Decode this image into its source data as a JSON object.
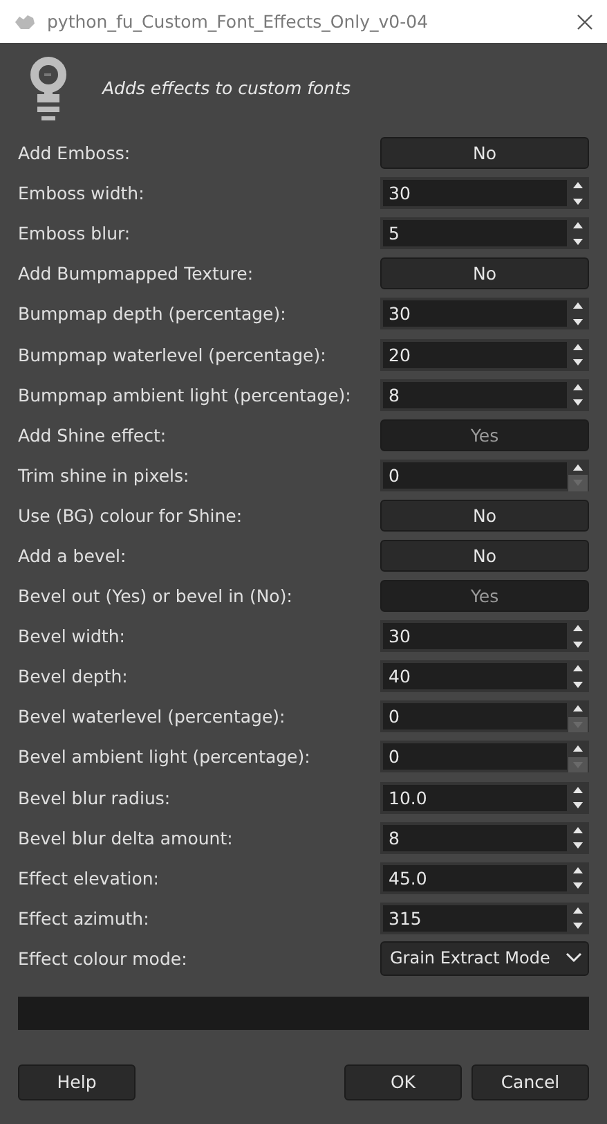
{
  "window": {
    "title": "python_fu_Custom_Font_Effects_Only_v0-04"
  },
  "description": "Adds effects to custom fonts",
  "params": [
    {
      "kind": "toggle",
      "label": "Add Emboss:",
      "value": "No",
      "on": false
    },
    {
      "kind": "spin",
      "label": "Emboss width:",
      "value": "30",
      "at_minimum": false
    },
    {
      "kind": "spin",
      "label": "Emboss blur:",
      "value": "5",
      "at_minimum": false
    },
    {
      "kind": "toggle",
      "label": "Add Bumpmapped Texture:",
      "value": "No",
      "on": false
    },
    {
      "kind": "spin",
      "label": "Bumpmap depth (percentage):",
      "value": "30",
      "at_minimum": false
    },
    {
      "kind": "spin",
      "label": "Bumpmap waterlevel (percentage):",
      "value": "20",
      "at_minimum": false
    },
    {
      "kind": "spin",
      "label": "Bumpmap ambient light (percentage):",
      "value": "8",
      "at_minimum": false
    },
    {
      "kind": "toggle",
      "label": "Add Shine effect:",
      "value": "Yes",
      "on": true
    },
    {
      "kind": "spin",
      "label": "Trim shine in pixels:",
      "value": "0",
      "at_minimum": true
    },
    {
      "kind": "toggle",
      "label": "Use (BG) colour for Shine:",
      "value": "No",
      "on": false
    },
    {
      "kind": "toggle",
      "label": "Add a bevel:",
      "value": "No",
      "on": false
    },
    {
      "kind": "toggle",
      "label": "Bevel out (Yes) or bevel in (No):",
      "value": "Yes",
      "on": true
    },
    {
      "kind": "spin",
      "label": "Bevel width:",
      "value": "30",
      "at_minimum": false
    },
    {
      "kind": "spin",
      "label": "Bevel depth:",
      "value": "40",
      "at_minimum": false
    },
    {
      "kind": "spin",
      "label": "Bevel waterlevel (percentage):",
      "value": "0",
      "at_minimum": true
    },
    {
      "kind": "spin",
      "label": "Bevel ambient light (percentage):",
      "value": "0",
      "at_minimum": true
    },
    {
      "kind": "spin",
      "label": "Bevel blur radius:",
      "value": "10.0",
      "at_minimum": false
    },
    {
      "kind": "spin",
      "label": "Bevel blur delta amount:",
      "value": "8",
      "at_minimum": false
    },
    {
      "kind": "spin",
      "label": "Effect elevation:",
      "value": "45.0",
      "at_minimum": false
    },
    {
      "kind": "spin",
      "label": "Effect azimuth:",
      "value": "315",
      "at_minimum": false
    },
    {
      "kind": "combo",
      "label": "Effect colour mode:",
      "value": "Grain Extract Mode"
    }
  ],
  "buttons": {
    "help": "Help",
    "ok": "OK",
    "cancel": "Cancel"
  }
}
